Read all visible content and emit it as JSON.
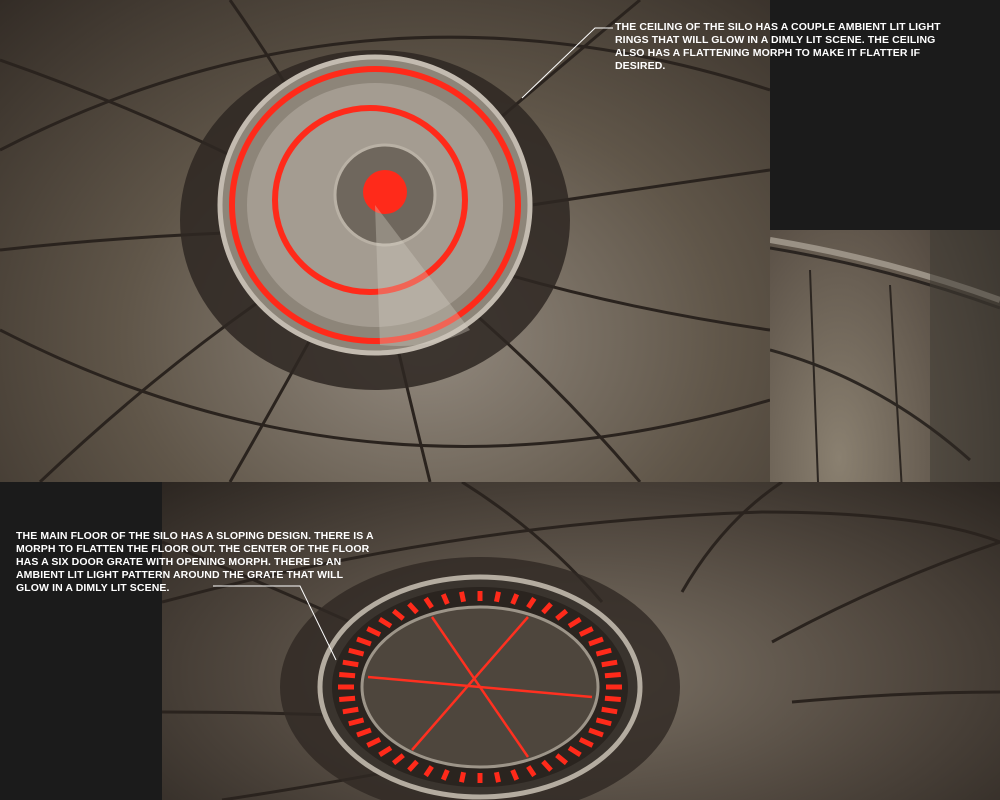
{
  "annotations": {
    "ceiling": "THE CEILING OF THE SILO HAS A COUPLE AMBIENT LIT LIGHT RINGS THAT WILL GLOW IN A DIMLY LIT SCENE. THE CEILING ALSO HAS A FLATTENING MORPH TO MAKE IT FLATTER IF DESIRED.",
    "floor": "THE MAIN FLOOR OF THE SILO HAS A SLOPING DESIGN.  THERE IS A MORPH TO FLATTEN THE FLOOR OUT.  THE CENTER OF THE FLOOR HAS A SIX DOOR GRATE WITH OPENING MORPH.  THERE IS AN AMBIENT LIT LIGHT PATTERN AROUND THE GRATE THAT WILL GLOW IN A DIMLY LIT SCENE."
  },
  "colors": {
    "background": "#1b1b1b",
    "glow": "#ff2a1a",
    "metal": "#7a7064",
    "caption_text": "#ffffff"
  }
}
